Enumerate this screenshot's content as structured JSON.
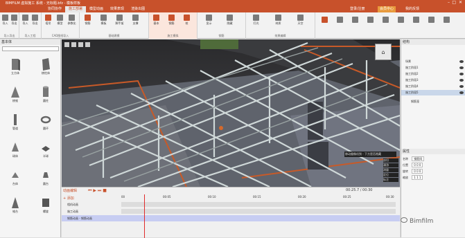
{
  "app": {
    "title": "BIMFILM 虚拟施工 系统 - 无标题.bfz - 模板样板"
  },
  "tabs": [
    "协同协作",
    "施工部署",
    "模型动画",
    "效果表现",
    "渲染出图"
  ],
  "tabs_active_index": 1,
  "header_right": {
    "login": "登录/注册",
    "vip": "会员中心",
    "feedback": "我的反馈"
  },
  "ribbon_groups": [
    {
      "label": "导入导出",
      "tools": [
        "导入",
        "导出"
      ]
    },
    {
      "label": "导入工程",
      "tools": [
        "导入",
        "导出"
      ]
    },
    {
      "label": "CAD图纸导入",
      "tools": [
        "塔吊",
        "模型",
        "参数化"
      ]
    },
    {
      "label": "基础建模",
      "tools": [
        "钢筋",
        "模板",
        "脚手架",
        "支撑"
      ]
    },
    {
      "label": "施工模拟",
      "tools": [
        "基本",
        "钢筋",
        "桩"
      ]
    },
    {
      "label": "钢筋",
      "tools": [
        "显示",
        "隐藏"
      ]
    },
    {
      "label": "效果编辑",
      "tools": [
        "灯光",
        "材质",
        "天空"
      ]
    }
  ],
  "left_panel": {
    "title": "基本体",
    "shapes": [
      "立方体",
      "棱柱体",
      "棱锥",
      "圆柱",
      "管道",
      "圆环",
      "球体",
      "半球",
      "台体",
      "圆台",
      "锥台",
      "螺旋"
    ]
  },
  "right_panel": {
    "title": "结构",
    "tree": [
      "场景",
      "施工阶段1",
      "施工阶段2",
      "施工阶段3",
      "施工阶段4",
      "施工阶段5",
      "钢筋笼"
    ],
    "props_title": "属性",
    "props": [
      {
        "k": "名称",
        "v": "钢筋网"
      },
      {
        "k": "位置",
        "v": "0 0 0"
      },
      {
        "k": "旋转",
        "v": "0 0 0"
      },
      {
        "k": "缩放",
        "v": "1 1 1"
      }
    ]
  },
  "viewport": {
    "tooltip": "移动摄像机到 - 下方是否隐藏",
    "side_items": [
      "剖切",
      "漫游",
      "测量",
      "定位",
      "标注"
    ],
    "time_readout": "00:25.7 / 00:30"
  },
  "timeline": {
    "label": "动画编辑",
    "add": "添加",
    "ticks": [
      "00",
      "00:05",
      "00:10",
      "00:15",
      "00:20",
      "00:25",
      "00:30"
    ],
    "rows": [
      "相机动画",
      "施工动画",
      "钢筋动画 - 钢筋动画"
    ]
  },
  "watermark": "Bimfilm",
  "colors": {
    "brand": "#c8512b",
    "selection": "#c7cdf2",
    "rebar": "#cfd8d8"
  }
}
